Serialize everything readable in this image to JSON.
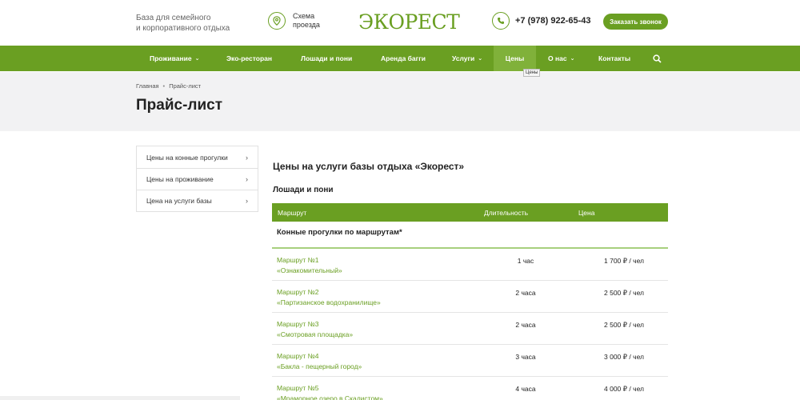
{
  "header": {
    "tagline_line1": "База для семейного",
    "tagline_line2": "и корпоративного отдыха",
    "scheme_line1": "Схема",
    "scheme_line2": "проезда",
    "logo_text": "ЭКОРЕСТ",
    "phone": "+7 (978) 922-65-43",
    "callback_label": "Заказать звонок",
    "icons": {
      "scheme": "map-pin-icon",
      "phone": "phone-icon",
      "search": "search-icon"
    }
  },
  "nav": {
    "items": [
      {
        "label": "Проживание",
        "has_dropdown": true
      },
      {
        "label": "Эко-ресторан",
        "has_dropdown": false
      },
      {
        "label": "Лошади и пони",
        "has_dropdown": false
      },
      {
        "label": "Аренда багги",
        "has_dropdown": false
      },
      {
        "label": "Услуги",
        "has_dropdown": true
      },
      {
        "label": "Цены",
        "has_dropdown": false,
        "active": true
      },
      {
        "label": "О нас",
        "has_dropdown": true
      },
      {
        "label": "Контакты",
        "has_dropdown": false
      }
    ],
    "tooltip": "Цены"
  },
  "breadcrumb": {
    "home": "Главная",
    "separator": "•",
    "current": "Прайс-лист"
  },
  "page_title": "Прайс-лист",
  "sidebar": {
    "items": [
      {
        "label": "Цены на конные прогулки"
      },
      {
        "label": "Цены на проживание"
      },
      {
        "label": "Цена на услуги базы"
      }
    ]
  },
  "content": {
    "title": "Цены на услуги базы отдыха «Экорест»",
    "section": "Лошади и пони",
    "table": {
      "columns": [
        "Маршрут",
        "Длительность",
        "Цена"
      ],
      "group": "Конные прогулки по маршрутам*",
      "rows": [
        {
          "route_name": "Маршрут №1",
          "route_desc": "«Ознакомительный»",
          "duration": "1 час",
          "price": "1 700 ₽ / чел"
        },
        {
          "route_name": "Маршрут №2",
          "route_desc": "«Партизанское водохранилище»",
          "duration": "2 часа",
          "price": "2 500 ₽ / чел"
        },
        {
          "route_name": "Маршрут №3",
          "route_desc": "«Смотровая площадка»",
          "duration": "2 часа",
          "price": "2 500 ₽ / чел"
        },
        {
          "route_name": "Маршрут №4",
          "route_desc": "«Бакла - пещерный город»",
          "duration": "3 часа",
          "price": "3 000 ₽ / чел"
        },
        {
          "route_name": "Маршрут №5",
          "route_desc": "«Мраморное озеро в Скалистом»",
          "duration": "4 часа",
          "price": "4 000 ₽ / чел"
        }
      ]
    }
  },
  "colors": {
    "brand_green": "#6a9f22",
    "active_nav": "#80b13a",
    "band_gray": "#f2f2f3"
  }
}
